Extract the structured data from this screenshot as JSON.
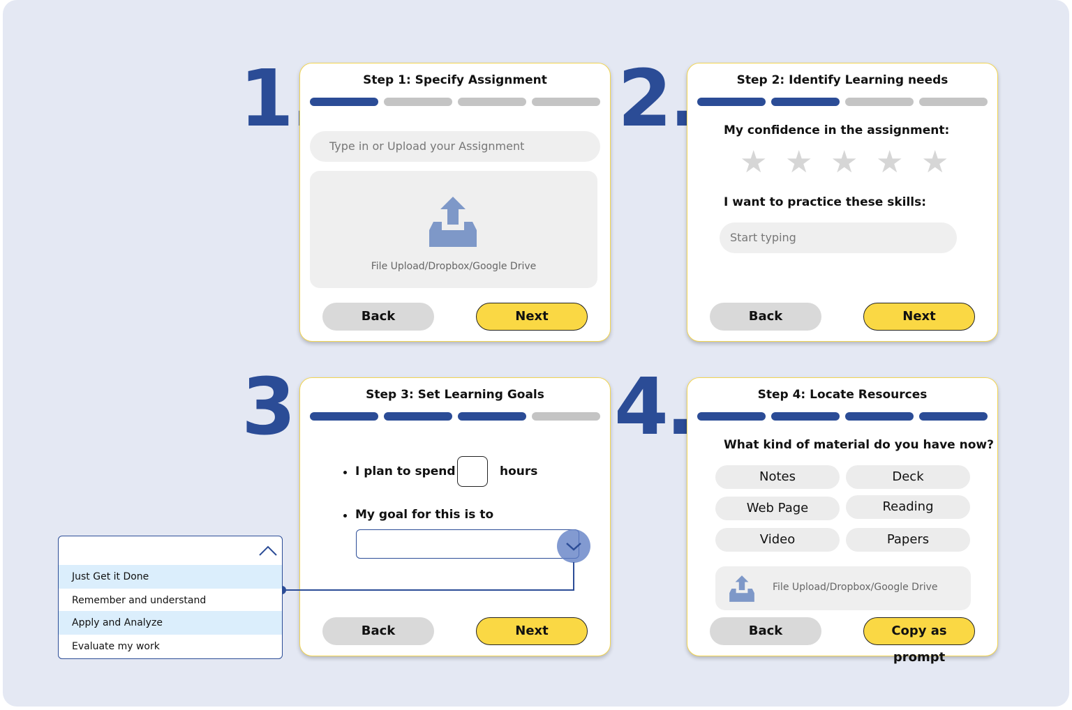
{
  "step_numbers": [
    "1.",
    "2.",
    "3.",
    "4."
  ],
  "colors": {
    "accent": "#2b4c96",
    "primary_button": "#fad844",
    "background": "#e4e8f3"
  },
  "step1": {
    "title": "Step 1: Specify Assignment",
    "progress_done": 1,
    "assignment_placeholder": "Type in or Upload your Assignment",
    "upload_icon": "upload-tray-icon",
    "upload_label": "File Upload/Dropbox/Google Drive",
    "back_label": "Back",
    "next_label": "Next"
  },
  "step2": {
    "title": "Step 2: Identify Learning needs",
    "progress_done": 2,
    "confidence_label": "My confidence in the assignment:",
    "stars_total": 5,
    "stars_selected": 0,
    "skills_label": "I want to practice these skills:",
    "skills_placeholder": "Start typing",
    "back_label": "Back",
    "next_label": "Next"
  },
  "step3": {
    "title": "Step 3: Set Learning Goals",
    "progress_done": 3,
    "plan_prefix": "I plan to spend",
    "plan_suffix": "hours",
    "hours_value": "",
    "goal_label": "My goal for this is to",
    "goal_value": "",
    "back_label": "Back",
    "next_label": "Next"
  },
  "step4": {
    "title": "Step 4: Locate Resources",
    "progress_done": 4,
    "question": "What kind of material do you have now?",
    "materials": [
      "Notes",
      "Deck",
      "Web Page",
      "Reading",
      "Video",
      "Papers"
    ],
    "upload_icon": "upload-tray-icon",
    "upload_label": "File Upload/Dropbox/Google Drive",
    "back_label": "Back",
    "copy_label": "Copy as prompt"
  },
  "goal_dropdown": {
    "options": [
      "Just Get it Done",
      "Remember and understand",
      "Apply and Analyze",
      "Evaluate my work"
    ],
    "highlighted": [
      0,
      2
    ]
  }
}
